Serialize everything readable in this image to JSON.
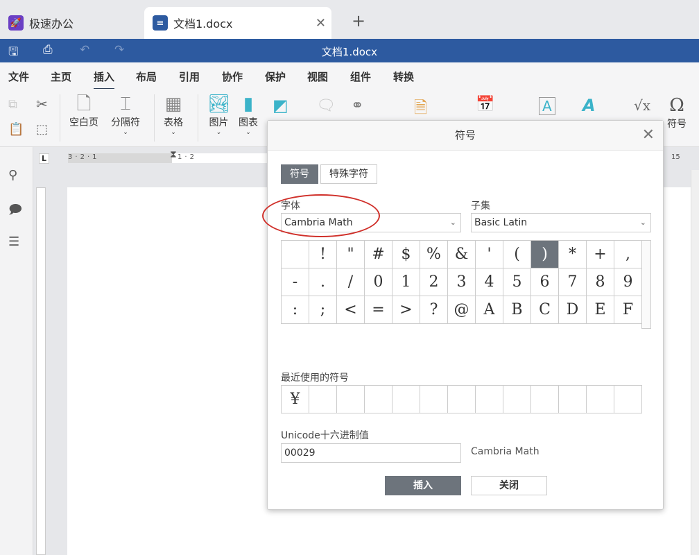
{
  "tabs": [
    {
      "label": "极速办公",
      "icon": "rocket-icon",
      "color": "#6a3fc4"
    },
    {
      "label": "文档1.docx",
      "icon": "document-icon",
      "color": "#2d5aa0",
      "active": true
    }
  ],
  "title": "文档1.docx",
  "quick_access": [
    "save-icon",
    "print-icon",
    "undo-icon",
    "redo-icon"
  ],
  "menu": [
    "文件",
    "主页",
    "插入",
    "布局",
    "引用",
    "协作",
    "保护",
    "视图",
    "组件",
    "转换"
  ],
  "active_menu": "插入",
  "toolbar": {
    "blank_page": "空白页",
    "separator": "分隔符",
    "table": "表格",
    "image": "图片",
    "chart": "图表",
    "symbol": "符号"
  },
  "ruler": {
    "labels": [
      "3",
      "2",
      "1",
      "1",
      "2",
      "15"
    ]
  },
  "dialog": {
    "title": "符号",
    "tabs": [
      "符号",
      "特殊字符"
    ],
    "font_label": "字体",
    "font_value": "Cambria Math",
    "subset_label": "子集",
    "subset_value": "Basic Latin",
    "symbols": [
      "",
      " !",
      "\"",
      "#",
      "$",
      "%",
      "&",
      "'",
      "(",
      ")",
      "*",
      "+",
      ",",
      "-",
      ".",
      "/",
      "0",
      "1",
      "2",
      "3",
      "4",
      "5",
      "6",
      "7",
      "8",
      "9",
      ":",
      ";",
      "<",
      "=",
      ">",
      "?",
      "@",
      "A",
      "B",
      "C",
      "D",
      "E",
      "F"
    ],
    "selected_symbol": ")",
    "recent_label": "最近使用的符号",
    "recent": [
      "¥",
      "",
      "",
      "",
      "",
      "",
      "",
      "",
      "",
      "",
      "",
      "",
      ""
    ],
    "unicode_label": "Unicode十六进制值",
    "unicode_value": "00029",
    "unicode_font": "Cambria Math",
    "insert_label": "插入",
    "close_label": "关闭",
    "accent": "#6d747c",
    "annotation_color": "#d0302a"
  }
}
